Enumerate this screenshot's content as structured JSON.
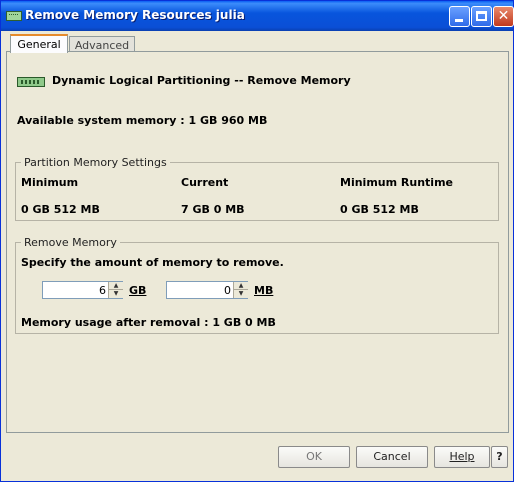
{
  "window": {
    "title": "Remove Memory Resources julia"
  },
  "tabs": [
    {
      "label": "General",
      "active": true
    },
    {
      "label": "Advanced",
      "active": false
    }
  ],
  "header": {
    "icon": "memory-module-icon",
    "text": "Dynamic Logical Partitioning -- Remove Memory"
  },
  "available": {
    "text": "Available system memory :  1 GB 960 MB"
  },
  "partition_settings": {
    "title": "Partition Memory Settings",
    "columns": [
      {
        "header": "Minimum",
        "value": "0 GB 512 MB"
      },
      {
        "header": "Current",
        "value": "7 GB 0 MB"
      },
      {
        "header": "Minimum Runtime",
        "value": "0 GB 512 MB"
      }
    ]
  },
  "remove_memory": {
    "title": "Remove Memory",
    "instruction": "Specify the amount of memory to remove.",
    "gb_value": "6",
    "gb_unit": "GB",
    "mb_value": "0",
    "mb_unit": "MB",
    "after_removal": "Memory usage after removal :  1 GB 0 MB"
  },
  "buttons": {
    "ok": "OK",
    "cancel": "Cancel",
    "help": "Help",
    "question": "?"
  }
}
